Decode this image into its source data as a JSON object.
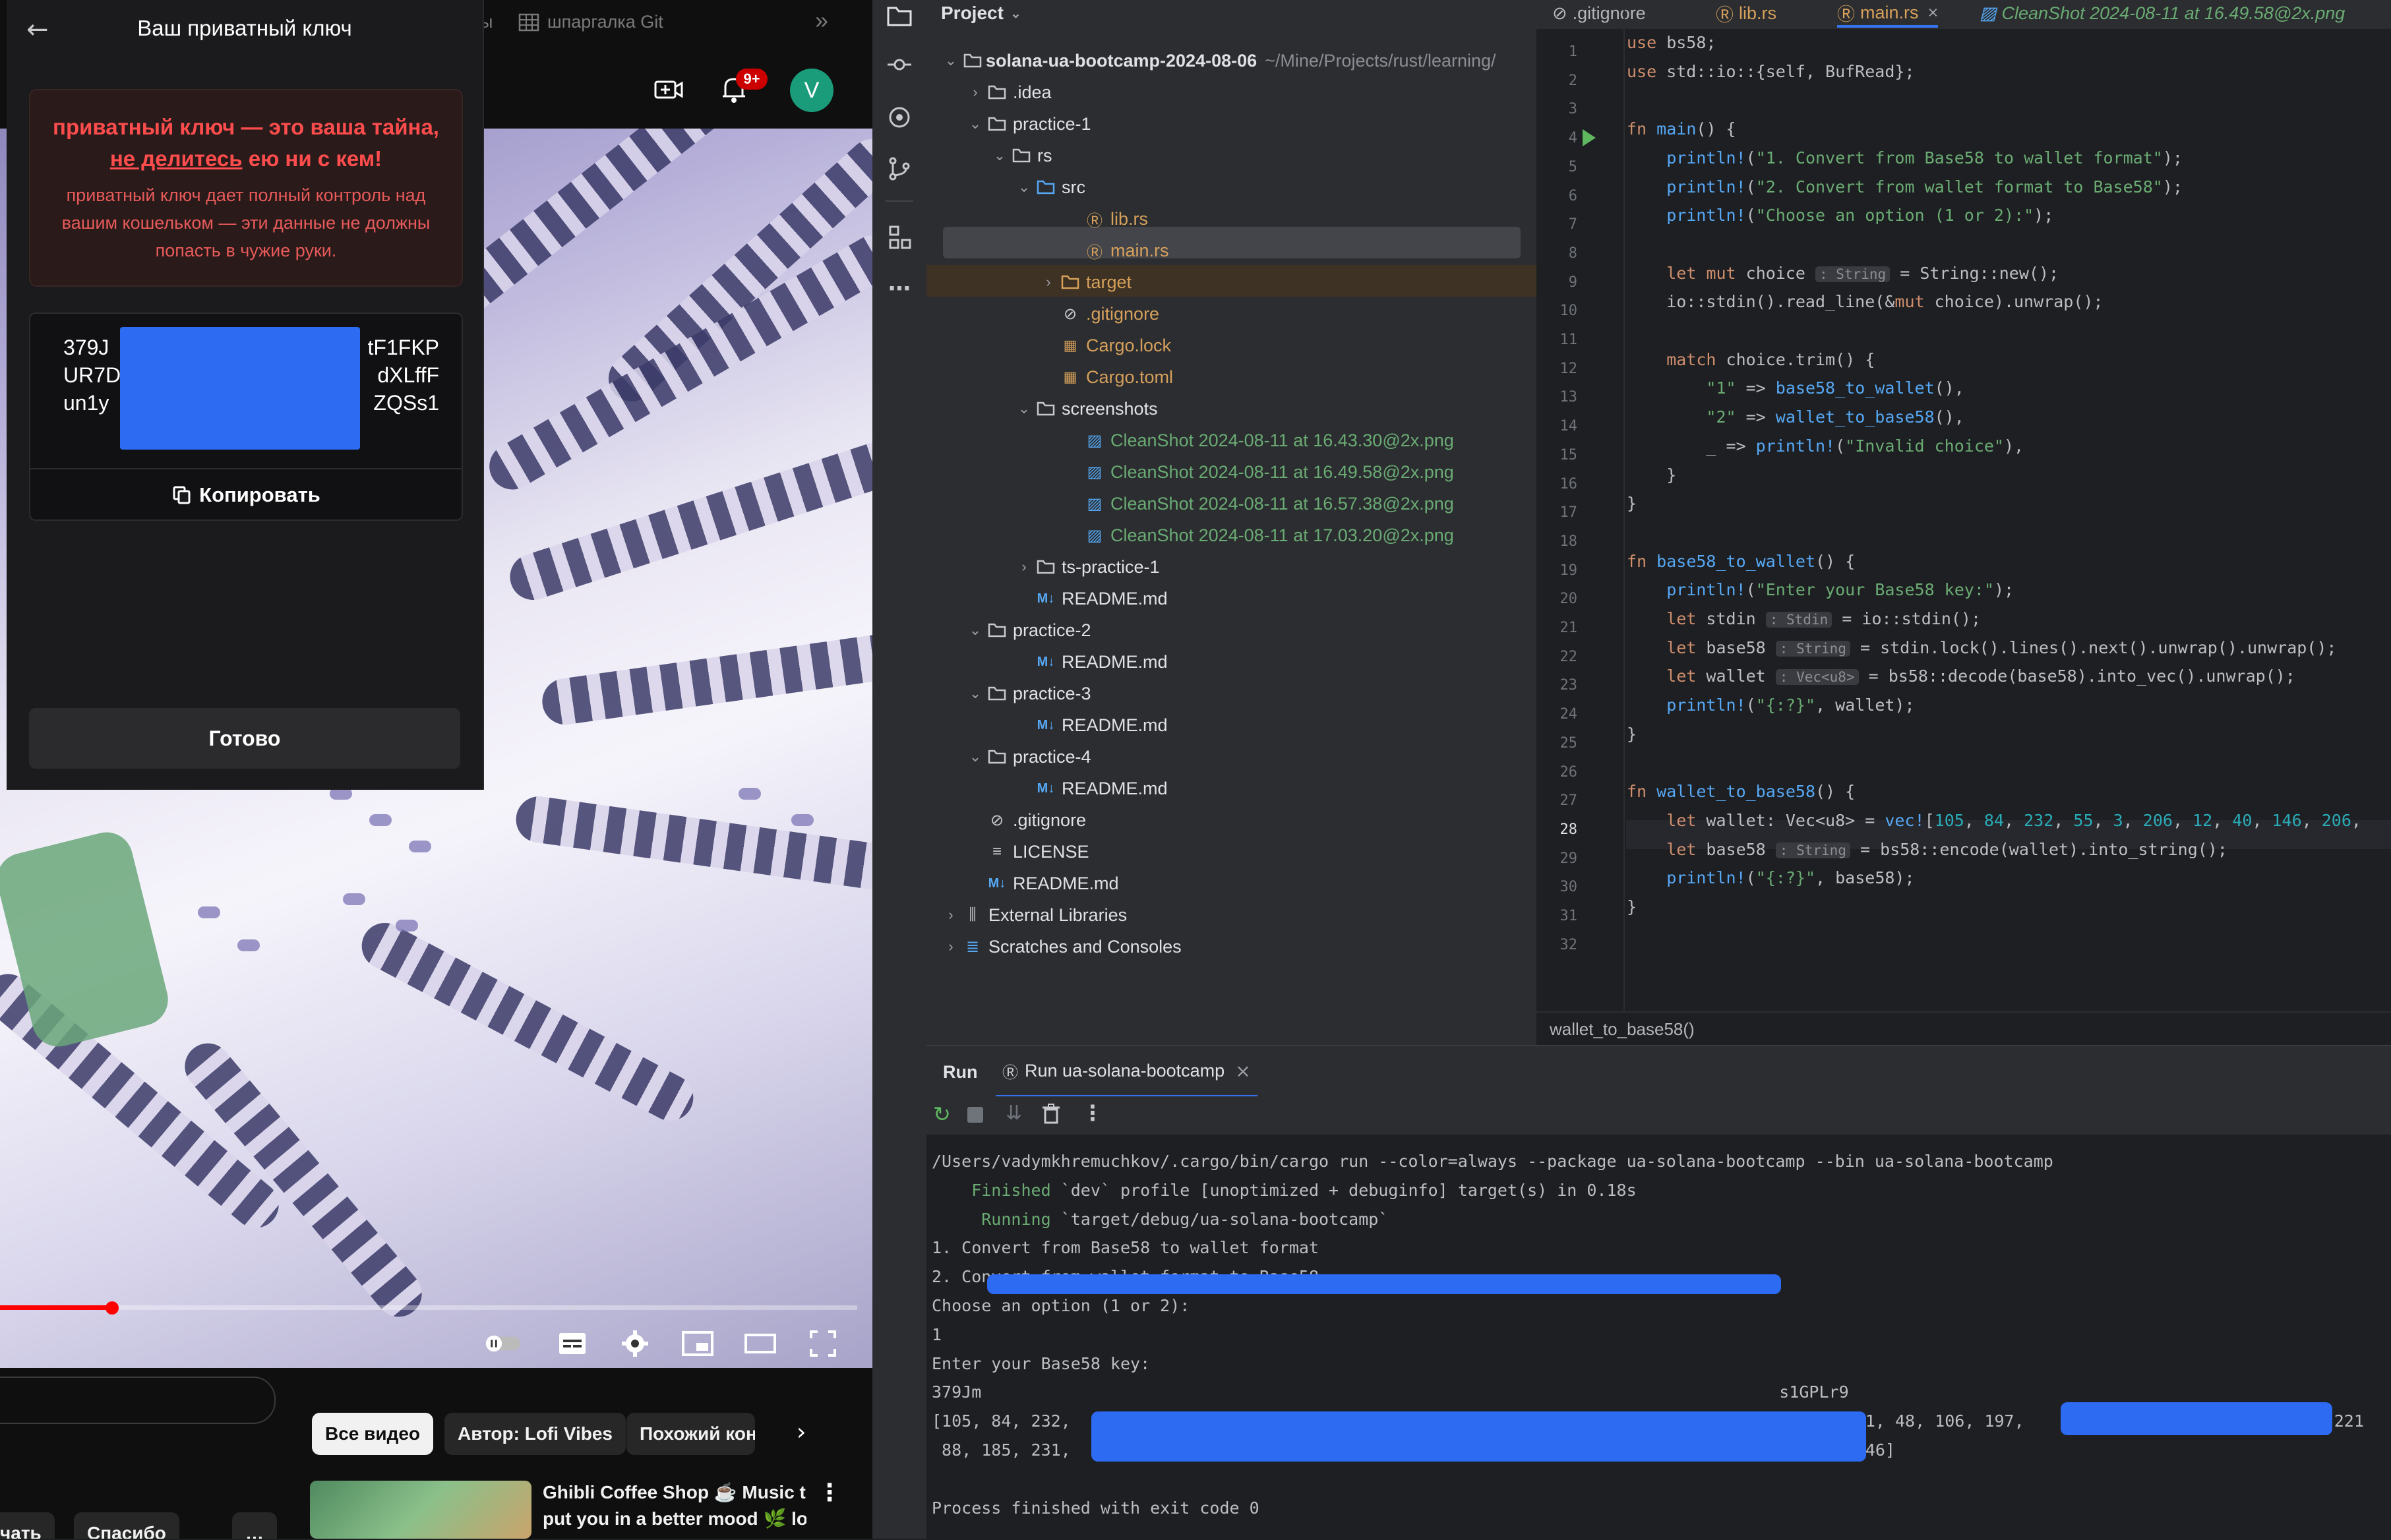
{
  "browser": {
    "tabs": [
      "ы",
      "шпаргалка Git"
    ],
    "more_tabs": "»",
    "notification_count": "9+",
    "avatar_letter": "V",
    "player_controls": [
      "pause-toggle",
      "subtitles",
      "settings",
      "miniplayer",
      "theater",
      "fullscreen"
    ],
    "chips": [
      "Все видео",
      "Автор: Lofi Vibes",
      "Похожий конт"
    ],
    "recommended": {
      "title_line1": "Ghibli Coffee Shop ☕ Music to",
      "title_line2": "put you in a better mood 🌿 lo..."
    },
    "bottom_pills": [
      "чать",
      "Спасибо",
      "…"
    ]
  },
  "wallet": {
    "title": "Ваш приватный ключ",
    "warning_line1": "приватный ключ — это ваша тайна,",
    "warning_link": "не делитесь",
    "warning_line2_rest": " ею ни с кем!",
    "warning_body": "приватный ключ дает полный контроль над вашим кошельком — эти данные не должны попасть в чужие руки.",
    "key_left": [
      "379J",
      "UR7D",
      "un1y"
    ],
    "key_right": [
      "tF1FKP",
      "dXLffF",
      "ZQSs1"
    ],
    "copy_label": "Копировать",
    "done_label": "Готово"
  },
  "ide": {
    "project_title": "Project",
    "root_name": "solana-ua-bootcamp-2024-08-06",
    "root_path": "~/Mine/Projects/rust/learning/",
    "tree": [
      {
        "label": ".idea",
        "color": "#dfe1e5"
      },
      {
        "label": "practice-1",
        "color": "#dfe1e5"
      },
      {
        "label": "rs",
        "color": "#dfe1e5"
      },
      {
        "label": "src",
        "color": "#dfe1e5"
      },
      {
        "label": "lib.rs",
        "color": "#d6a05b"
      },
      {
        "label": "main.rs",
        "color": "#d6a05b"
      },
      {
        "label": "target",
        "color": "#d6a05b"
      },
      {
        "label": ".gitignore",
        "color": "#d6a05b"
      },
      {
        "label": "Cargo.lock",
        "color": "#d6a05b"
      },
      {
        "label": "Cargo.toml",
        "color": "#d6a05b"
      },
      {
        "label": "screenshots",
        "color": "#dfe1e5"
      },
      {
        "label": "CleanShot 2024-08-11 at 16.43.30@2x.png",
        "color": "#6aab73"
      },
      {
        "label": "CleanShot 2024-08-11 at 16.49.58@2x.png",
        "color": "#6aab73"
      },
      {
        "label": "CleanShot 2024-08-11 at 16.57.38@2x.png",
        "color": "#6aab73"
      },
      {
        "label": "CleanShot 2024-08-11 at 17.03.20@2x.png",
        "color": "#6aab73"
      },
      {
        "label": "ts-practice-1",
        "color": "#dfe1e5"
      },
      {
        "label": "README.md",
        "color": "#dfe1e5"
      },
      {
        "label": "practice-2",
        "color": "#dfe1e5"
      },
      {
        "label": "README.md",
        "color": "#dfe1e5"
      },
      {
        "label": "practice-3",
        "color": "#dfe1e5"
      },
      {
        "label": "README.md",
        "color": "#dfe1e5"
      },
      {
        "label": "practice-4",
        "color": "#dfe1e5"
      },
      {
        "label": "README.md",
        "color": "#dfe1e5"
      },
      {
        "label": ".gitignore",
        "color": "#dfe1e5"
      },
      {
        "label": "LICENSE",
        "color": "#dfe1e5"
      },
      {
        "label": "README.md",
        "color": "#dfe1e5"
      },
      {
        "label": "External Libraries",
        "color": "#dfe1e5"
      },
      {
        "label": "Scratches and Consoles",
        "color": "#dfe1e5"
      }
    ],
    "editor_tabs": [
      ".gitignore",
      "lib.rs",
      "main.rs",
      "CleanShot 2024-08-11 at 16.49.58@2x.png"
    ],
    "line_numbers": [
      "1",
      "2",
      "3",
      "4",
      "5",
      "6",
      "7",
      "8",
      "9",
      "10",
      "11",
      "12",
      "13",
      "14",
      "15",
      "16",
      "17",
      "18",
      "19",
      "20",
      "21",
      "22",
      "23",
      "24",
      "25",
      "26",
      "27",
      "28",
      "29",
      "30",
      "31",
      "32"
    ],
    "current_line": "28",
    "code": {
      "l1": "use bs58;",
      "l2": "use std::io::{self, BufRead};",
      "l4": "fn main() {",
      "l5": "println!(\"1. Convert from Base58 to wallet format\");",
      "l6": "println!(\"2. Convert from wallet format to Base58\");",
      "l7": "println!(\"Choose an option (1 or 2):\");",
      "l9a": "let mut choice",
      "l9hint": ": String",
      "l9b": " = String::new();",
      "l10": "io::stdin().read_line(&mut choice).unwrap();",
      "l12": "match choice.trim() {",
      "l13": "\"1\" => base58_to_wallet(),",
      "l14": "\"2\" => wallet_to_base58(),",
      "l15": "_ => println!(\"Invalid choice\"),",
      "l16": "}",
      "l17": "}",
      "l19": "fn base58_to_wallet() {",
      "l20": "println!(\"Enter your Base58 key:\");",
      "l21a": "let stdin",
      "l21hint": ": Stdin",
      "l21b": " = io::stdin();",
      "l22a": "let base58",
      "l22hint": ": String",
      "l22b": " = stdin.lock().lines().next().unwrap().unwrap();",
      "l23a": "let wallet",
      "l23hint": ": Vec<u8>",
      "l23b": " = bs58::decode(base58).into_vec().unwrap();",
      "l24": "println!(\"{:?}\", wallet);",
      "l25": "}",
      "l27": "fn wallet_to_base58() {",
      "l28": "let wallet: Vec<u8> = vec![105, 84, 232, 55, 3, 206, 12, 40, 146, 206,",
      "l29a": "let base58",
      "l29hint": ": String",
      "l29b": " = bs58::encode(wallet).into_string();",
      "l30": "println!(\"{:?}\", base58);",
      "l31": "}"
    },
    "breadcrumb": "wallet_to_base58()",
    "run_title": "Run",
    "run_tab": "Run ua-solana-bootcamp",
    "console": {
      "c1": "/Users/vadymkhremuchkov/.cargo/bin/cargo run --color=always --package ua-solana-bootcamp --bin ua-solana-bootcamp",
      "c2a": "    Finished",
      "c2b": " `dev` profile [unoptimized + debuginfo] target(s) in 0.18s",
      "c3a": "     Running",
      "c3b": " `target/debug/ua-solana-bootcamp`",
      "c4": "1. Convert from Base58 to wallet format",
      "c5": "2. Convert from wallet format to Base58",
      "c6": "Choose an option (1 or 2):",
      "c7": "1",
      "c8": "Enter your Base58 key:",
      "c9a": "379Jm",
      "c9b": "s1GPLr9",
      "c10a": "[105, 84, 232,",
      "c10b": "231, 48, 106, 197,",
      "c10c": ", 221",
      "c11a": " 88, 185, 231,",
      "c11b": ", 46]",
      "c13": "Process finished with exit code 0"
    }
  },
  "colors": {
    "redaction": "#2d6bf3",
    "youtube_red": "#ff0000",
    "warning_red": "#ff4d4d"
  }
}
